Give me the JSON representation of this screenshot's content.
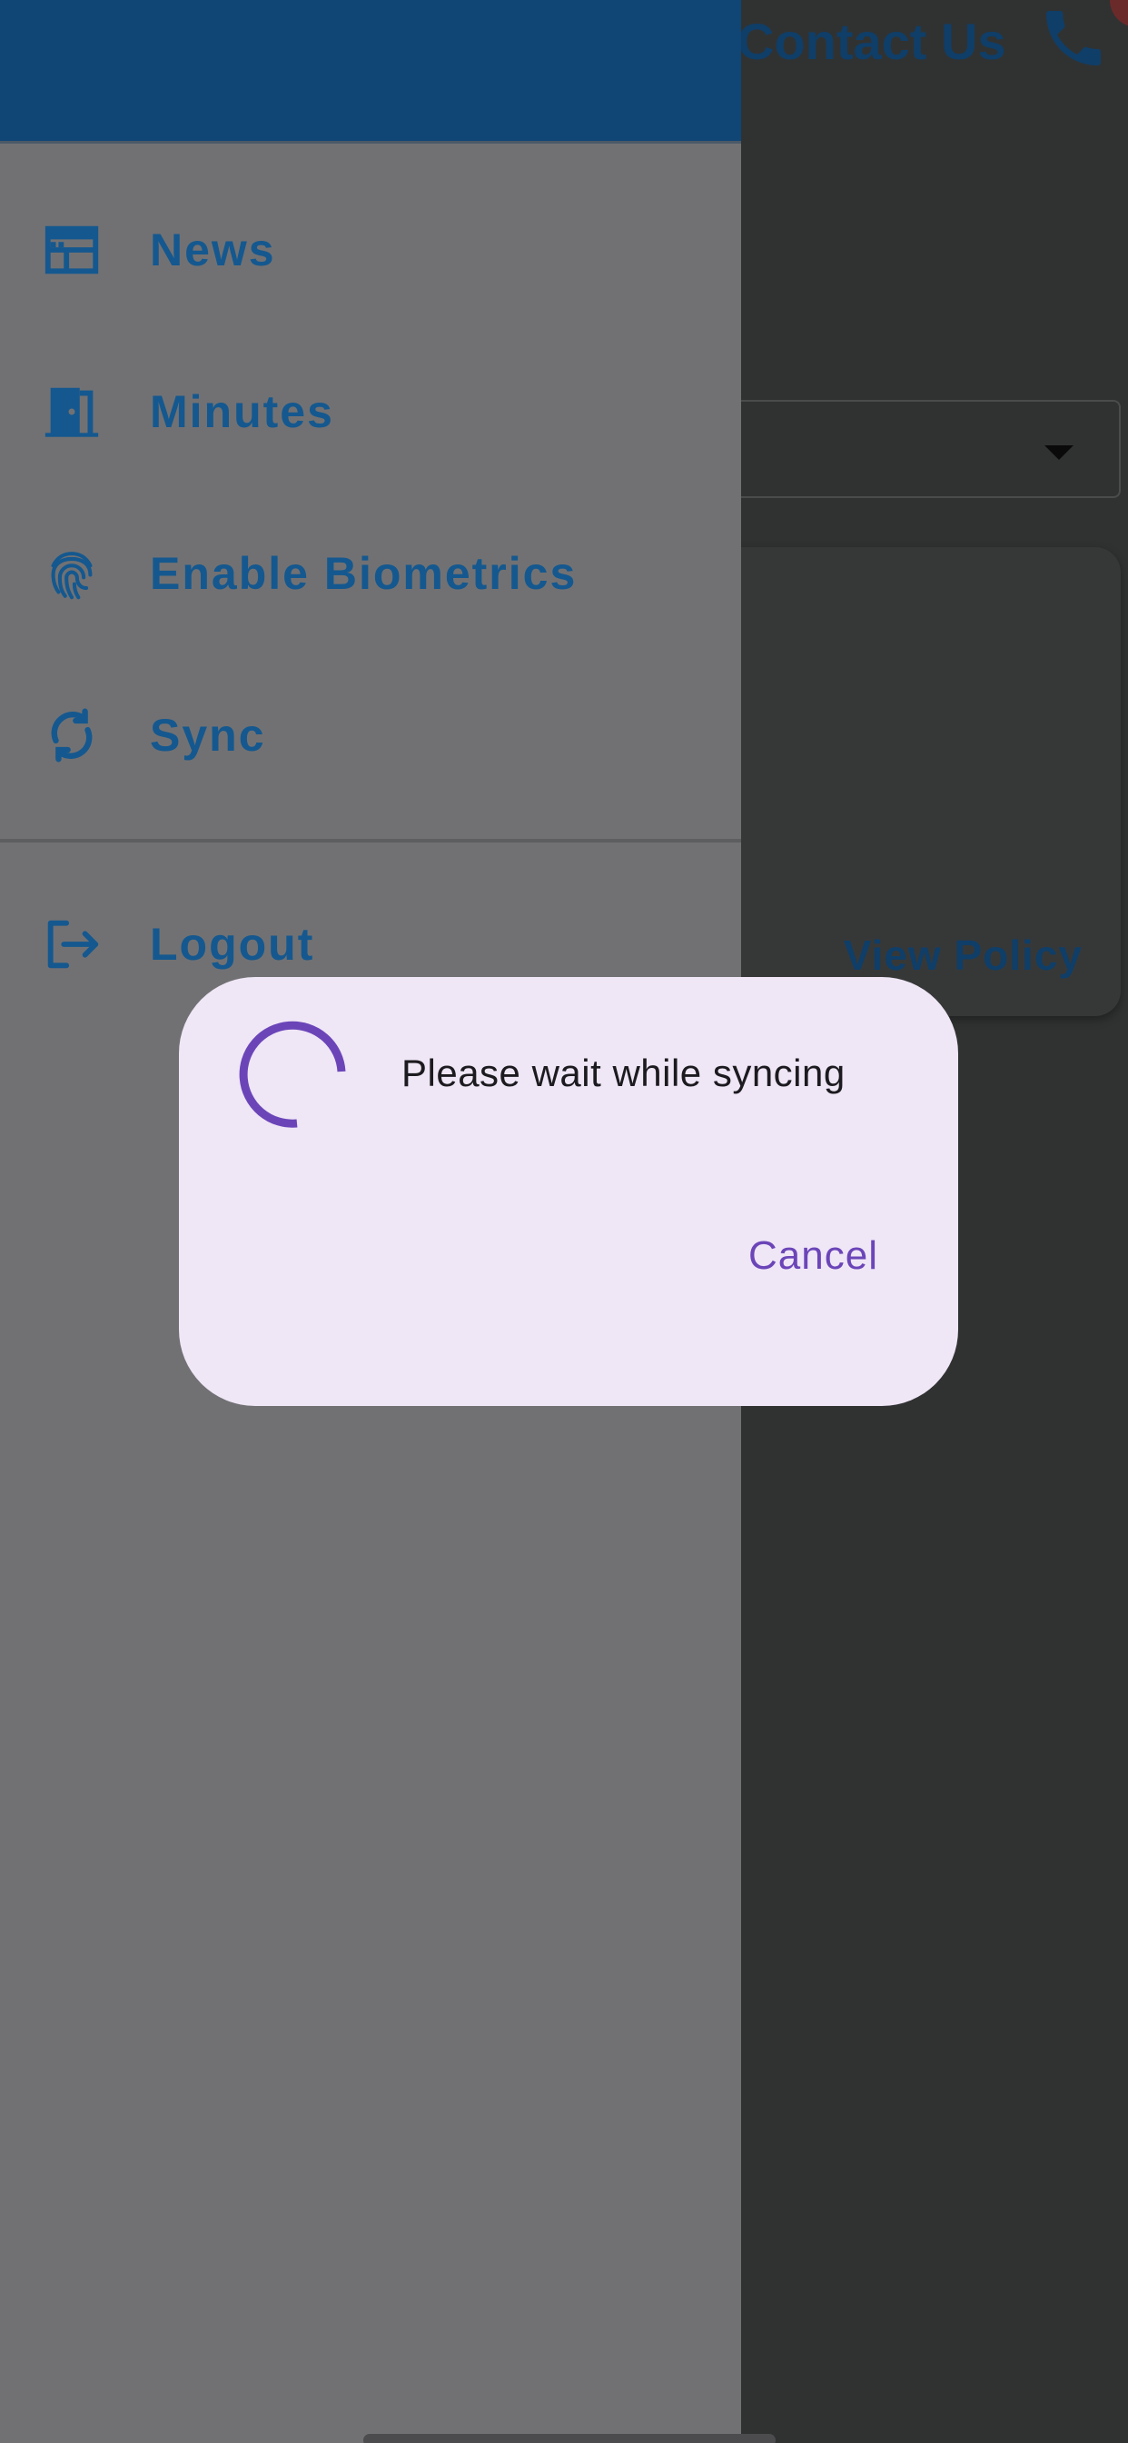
{
  "background": {
    "header_title": "Contact Us",
    "view_policy_label": "View Policy"
  },
  "drawer": {
    "items": [
      {
        "label": "News",
        "icon": "newspaper-icon"
      },
      {
        "label": "Minutes",
        "icon": "door-icon"
      },
      {
        "label": "Enable Biometrics",
        "icon": "fingerprint-icon"
      },
      {
        "label": "Sync",
        "icon": "sync-icon"
      }
    ],
    "logout": {
      "label": "Logout",
      "icon": "logout-icon"
    }
  },
  "dialog": {
    "message": "Please wait while syncing",
    "cancel_label": "Cancel"
  },
  "colors": {
    "drawer_header": "#0f4676",
    "drawer_text": "#14588f",
    "dialog_bg": "#efe6f6",
    "accent_purple": "#6b45b8"
  }
}
